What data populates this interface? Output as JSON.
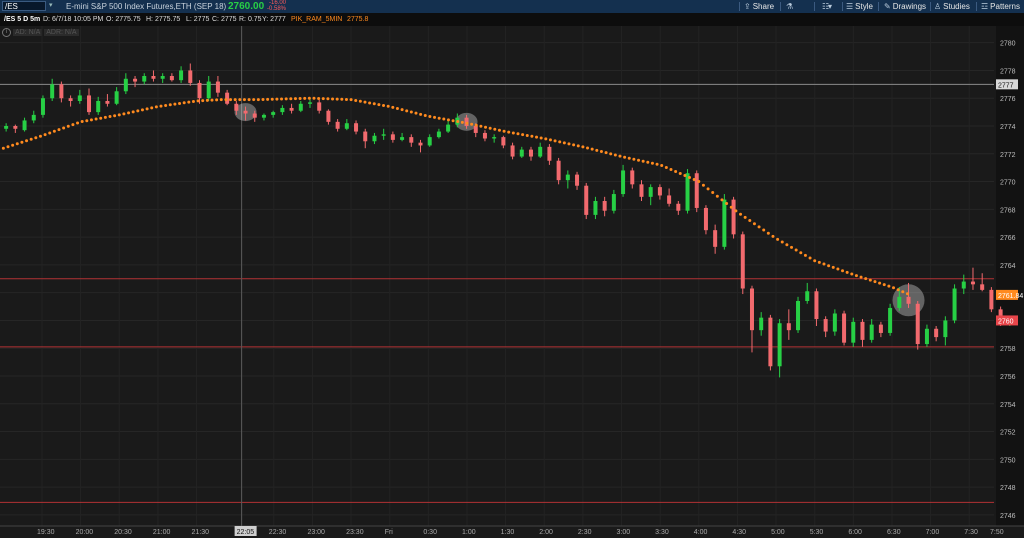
{
  "header": {
    "symbol": "/ES",
    "period": "5 D 5m",
    "description": "E-mini S&P 500 Index Futures,ETH (SEP 18)",
    "last_price": "2760.00",
    "change": "-16.00",
    "change_pct": "-0.58%",
    "toolbar": [
      {
        "label": "Share",
        "icon": "share-icon"
      },
      {
        "label": "",
        "icon": "flask-icon"
      },
      {
        "label": "",
        "icon": "sliders-icon"
      },
      {
        "label": "",
        "icon": "timeframe-icon"
      },
      {
        "label": "Style",
        "icon": "style-icon"
      },
      {
        "label": "Drawings",
        "icon": "pencil-icon"
      },
      {
        "label": "Studies",
        "icon": "studies-icon"
      },
      {
        "label": "Patterns",
        "icon": "patterns-icon"
      }
    ]
  },
  "info": {
    "symbol_period": "/ES 5 D 5m",
    "date": "D: 6/7/18 10:05 PM",
    "open": "O: 2775.75",
    "high": "H: 2775.75",
    "low": "L: 2775",
    "close": "C: 2775",
    "range": "R: 0.75",
    "y": "Y: 2777",
    "study_name": "PIK_RAM_5MIN",
    "study_value": "2775.8",
    "ad": "AD: N/A",
    "adr": "ADR: N/A"
  },
  "colors": {
    "up": "#27d045",
    "down": "#f26a6e",
    "ma": "#ff8a1e",
    "level": "#b23234"
  },
  "chart_data": {
    "type": "candlestick",
    "x_ticks": [
      "19:30",
      "20:00",
      "20:30",
      "21:00",
      "21:30",
      "22:05",
      "22:30",
      "23:00",
      "23:30",
      "Fri",
      "0:30",
      "1:00",
      "1:30",
      "2:00",
      "2:30",
      "3:00",
      "3:30",
      "4:00",
      "4:30",
      "5:00",
      "5:30",
      "6:00",
      "6:30",
      "7:00",
      "7:30",
      "7:50"
    ],
    "y_ticks": [
      2780,
      2778,
      2776,
      2774,
      2772,
      2770,
      2768,
      2766,
      2764,
      2762,
      2760,
      2758,
      2756,
      2754,
      2752,
      2750,
      2748,
      2746
    ],
    "y_range": [
      2745.2,
      2781.2
    ],
    "price_labels": [
      {
        "value": 2777,
        "label": "2777",
        "style": "white"
      },
      {
        "value": 2761.84,
        "label": "2761.84",
        "style": "orange"
      },
      {
        "value": 2760,
        "label": "2760",
        "style": "red"
      }
    ],
    "horizontal_levels": [
      2777,
      2763,
      2758.1,
      2746.9
    ],
    "crosshair_time": "22:05",
    "candles": [
      [
        2774,
        2774.3,
        2773.6,
        2773.8
      ],
      [
        2773.8,
        2774.2,
        2773.6,
        2774
      ],
      [
        2774,
        2774.1,
        2773.5,
        2773.8
      ],
      [
        2773.7,
        2774.6,
        2773.6,
        2774.4
      ],
      [
        2774.4,
        2775.1,
        2774.2,
        2774.8
      ],
      [
        2774.8,
        2776.2,
        2774.6,
        2776
      ],
      [
        2776,
        2777.4,
        2775.8,
        2777
      ],
      [
        2777,
        2777.2,
        2775.7,
        2776
      ],
      [
        2776,
        2776.2,
        2775.4,
        2775.8
      ],
      [
        2775.8,
        2776.6,
        2775.6,
        2776.2
      ],
      [
        2776.2,
        2776.7,
        2774.8,
        2775
      ],
      [
        2775,
        2776.1,
        2774.8,
        2775.8
      ],
      [
        2775.8,
        2776.3,
        2775.4,
        2775.6
      ],
      [
        2775.6,
        2776.8,
        2775.5,
        2776.5
      ],
      [
        2776.5,
        2777.8,
        2776.3,
        2777.4
      ],
      [
        2777.4,
        2777.6,
        2776.8,
        2777.2
      ],
      [
        2777.2,
        2777.8,
        2777,
        2777.6
      ],
      [
        2777.6,
        2778,
        2777.2,
        2777.4
      ],
      [
        2777.4,
        2777.8,
        2777.1,
        2777.6
      ],
      [
        2777.6,
        2777.8,
        2777.2,
        2777.3
      ],
      [
        2777.3,
        2778.3,
        2777.1,
        2778
      ],
      [
        2778,
        2778.5,
        2776.9,
        2777.1
      ],
      [
        2777.1,
        2777.3,
        2775.6,
        2776
      ],
      [
        2776,
        2777.6,
        2775.8,
        2777.2
      ],
      [
        2777.2,
        2777.6,
        2776.1,
        2776.4
      ],
      [
        2776.4,
        2776.6,
        2775.5,
        2775.6
      ],
      [
        2775.6,
        2775.8,
        2774.8,
        2775.1
      ],
      [
        2775.1,
        2775.4,
        2774.4,
        2774.9
      ],
      [
        2774.9,
        2775.1,
        2774.3,
        2774.6
      ],
      [
        2774.6,
        2774.9,
        2774.4,
        2774.8
      ],
      [
        2774.8,
        2775.1,
        2774.6,
        2775
      ],
      [
        2775,
        2775.5,
        2774.8,
        2775.3
      ],
      [
        2775.3,
        2775.6,
        2774.9,
        2775.1
      ],
      [
        2775.1,
        2775.8,
        2775,
        2775.6
      ],
      [
        2775.6,
        2776,
        2775.3,
        2775.7
      ],
      [
        2775.7,
        2775.9,
        2774.9,
        2775.1
      ],
      [
        2775.1,
        2775.2,
        2774.1,
        2774.3
      ],
      [
        2774.3,
        2774.5,
        2773.6,
        2773.8
      ],
      [
        2773.8,
        2774.5,
        2773.7,
        2774.2
      ],
      [
        2774.2,
        2774.4,
        2773.4,
        2773.6
      ],
      [
        2773.6,
        2773.8,
        2772.4,
        2772.9
      ],
      [
        2772.9,
        2773.5,
        2772.7,
        2773.3
      ],
      [
        2773.3,
        2773.8,
        2773,
        2773.4
      ],
      [
        2773.4,
        2773.6,
        2772.8,
        2773
      ],
      [
        2773,
        2773.5,
        2772.9,
        2773.2
      ],
      [
        2773.2,
        2773.4,
        2772.5,
        2772.8
      ],
      [
        2772.8,
        2773,
        2772.1,
        2772.6
      ],
      [
        2772.6,
        2773.4,
        2772.5,
        2773.2
      ],
      [
        2773.2,
        2773.8,
        2773.1,
        2773.6
      ],
      [
        2773.6,
        2774.4,
        2773.5,
        2774.1
      ],
      [
        2774.1,
        2774.9,
        2773.9,
        2774.6
      ],
      [
        2774.6,
        2774.8,
        2773.8,
        2774
      ],
      [
        2774,
        2774.2,
        2773.2,
        2773.5
      ],
      [
        2773.5,
        2773.7,
        2772.9,
        2773.1
      ],
      [
        2773.1,
        2773.4,
        2772.8,
        2773.2
      ],
      [
        2773.2,
        2773.3,
        2772.4,
        2772.6
      ],
      [
        2772.6,
        2772.8,
        2771.6,
        2771.8
      ],
      [
        2771.8,
        2772.5,
        2771.7,
        2772.3
      ],
      [
        2772.3,
        2772.5,
        2771.5,
        2771.8
      ],
      [
        2771.8,
        2772.8,
        2771.7,
        2772.5
      ],
      [
        2772.5,
        2772.7,
        2771.2,
        2771.5
      ],
      [
        2771.5,
        2771.7,
        2769.8,
        2770.1
      ],
      [
        2770.1,
        2770.8,
        2769.5,
        2770.5
      ],
      [
        2770.5,
        2770.7,
        2769.4,
        2769.7
      ],
      [
        2769.7,
        2769.9,
        2767.3,
        2767.6
      ],
      [
        2767.6,
        2768.9,
        2767.3,
        2768.6
      ],
      [
        2768.6,
        2768.9,
        2767.5,
        2767.9
      ],
      [
        2767.9,
        2769.4,
        2767.7,
        2769.1
      ],
      [
        2769.1,
        2771.2,
        2768.9,
        2770.8
      ],
      [
        2770.8,
        2771,
        2769.5,
        2769.8
      ],
      [
        2769.8,
        2770.1,
        2768.6,
        2768.9
      ],
      [
        2768.9,
        2769.8,
        2768.3,
        2769.6
      ],
      [
        2769.6,
        2769.8,
        2768.7,
        2769
      ],
      [
        2769,
        2769.5,
        2768.2,
        2768.4
      ],
      [
        2768.4,
        2768.6,
        2767.6,
        2767.9
      ],
      [
        2767.9,
        2770.9,
        2767.7,
        2770.6
      ],
      [
        2770.6,
        2770.8,
        2767.8,
        2768.1
      ],
      [
        2768.1,
        2768.3,
        2766.2,
        2766.5
      ],
      [
        2766.5,
        2766.9,
        2764.8,
        2765.3
      ],
      [
        2765.3,
        2769.1,
        2765.1,
        2768.7
      ],
      [
        2768.7,
        2768.9,
        2765.9,
        2766.2
      ],
      [
        2766.2,
        2766.4,
        2761.9,
        2762.3
      ],
      [
        2762.3,
        2762.5,
        2757.7,
        2759.3
      ],
      [
        2759.3,
        2760.6,
        2758.9,
        2760.2
      ],
      [
        2760.2,
        2760.4,
        2756.4,
        2756.7
      ],
      [
        2756.7,
        2760.1,
        2755.9,
        2759.8
      ],
      [
        2759.8,
        2760.8,
        2758.6,
        2759.3
      ],
      [
        2759.3,
        2761.7,
        2759.1,
        2761.4
      ],
      [
        2761.4,
        2762.7,
        2761.2,
        2762.1
      ],
      [
        2762.1,
        2762.3,
        2759.6,
        2760.1
      ],
      [
        2760.1,
        2760.3,
        2758.8,
        2759.2
      ],
      [
        2759.2,
        2760.8,
        2758.9,
        2760.5
      ],
      [
        2760.5,
        2760.7,
        2758.2,
        2758.4
      ],
      [
        2758.4,
        2760.2,
        2758.1,
        2759.9
      ],
      [
        2759.9,
        2760.1,
        2758.1,
        2758.6
      ],
      [
        2758.6,
        2760.1,
        2758.4,
        2759.7
      ],
      [
        2759.7,
        2759.9,
        2758.8,
        2759.1
      ],
      [
        2759.1,
        2761.2,
        2758.9,
        2760.9
      ],
      [
        2760.9,
        2762.4,
        2760.7,
        2761.7
      ],
      [
        2761.7,
        2762.7,
        2760.9,
        2761.2
      ],
      [
        2761.2,
        2761.4,
        2757.9,
        2758.3
      ],
      [
        2758.3,
        2759.7,
        2758.1,
        2759.4
      ],
      [
        2759.4,
        2759.6,
        2758.5,
        2758.8
      ],
      [
        2758.8,
        2760.3,
        2758.2,
        2760
      ],
      [
        2760,
        2762.6,
        2759.8,
        2762.3
      ],
      [
        2762.3,
        2763.3,
        2761.9,
        2762.8
      ],
      [
        2762.8,
        2763.8,
        2762.2,
        2762.6
      ],
      [
        2762.6,
        2763.4,
        2762.1,
        2762.2
      ],
      [
        2762.2,
        2762.4,
        2760.6,
        2760.8
      ],
      [
        2760.8,
        2761,
        2759.6,
        2759.9
      ],
      [
        2759.9,
        2760.3,
        2759.6,
        2760
      ]
    ],
    "moving_average": {
      "name": "PIK_RAM_5MIN",
      "x_times": [
        "19:00",
        "19:30",
        "20:00",
        "20:30",
        "21:00",
        "21:30",
        "21:50",
        "22:20",
        "23:00",
        "23:30",
        "0:00",
        "0:30",
        "1:00",
        "1:30",
        "2:00",
        "2:30",
        "3:00",
        "3:30",
        "4:00",
        "4:30",
        "5:00",
        "5:30",
        "6:00",
        "6:30",
        "6:45"
      ],
      "values": [
        2772.4,
        2773.3,
        2774.3,
        2774.8,
        2775.4,
        2775.8,
        2775.9,
        2775.9,
        2776,
        2775.9,
        2775.4,
        2774.7,
        2774.2,
        2773.6,
        2773.1,
        2772.5,
        2771.8,
        2771.2,
        2770,
        2767.8,
        2765.9,
        2764.3,
        2763.3,
        2762.4,
        2761.8
      ]
    },
    "highlight_times": [
      "22:05",
      "1:00",
      "6:40"
    ],
    "grid": true
  }
}
